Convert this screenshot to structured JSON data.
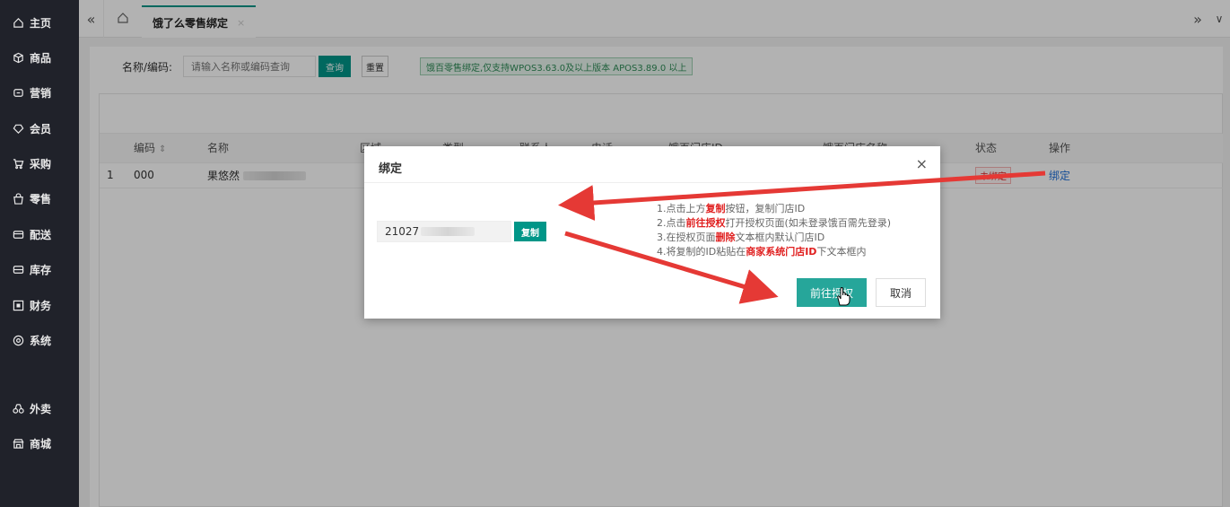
{
  "sidebar": {
    "items": [
      {
        "label": "主页",
        "icon": "home-icon"
      },
      {
        "label": "商品",
        "icon": "box-icon"
      },
      {
        "label": "营销",
        "icon": "tag-icon"
      },
      {
        "label": "会员",
        "icon": "member-icon"
      },
      {
        "label": "采购",
        "icon": "cart-icon"
      },
      {
        "label": "零售",
        "icon": "bag-icon"
      },
      {
        "label": "配送",
        "icon": "truck-icon"
      },
      {
        "label": "库存",
        "icon": "stock-icon"
      },
      {
        "label": "财务",
        "icon": "finance-icon"
      },
      {
        "label": "系统",
        "icon": "settings-icon"
      },
      {
        "label": "外卖",
        "icon": "takeout-icon"
      },
      {
        "label": "商城",
        "icon": "store-icon"
      }
    ]
  },
  "tabs": {
    "prev": "«",
    "next": "»",
    "dropdown": "∨",
    "active_label": "饿了么零售绑定",
    "close": "×"
  },
  "filter": {
    "label": "名称/编码:",
    "placeholder": "请输入名称或编码查询",
    "query_label": "查询",
    "reset_label": "重置",
    "notice": "饿百零售绑定,仅支持WPOS3.63.0及以上版本 APOS3.89.0 以上"
  },
  "table": {
    "headers": [
      "编码",
      "名称",
      "区域",
      "类型",
      "联系人",
      "电话",
      "饿百门店ID",
      "饿百门店名称",
      "状态",
      "操作"
    ],
    "rows": [
      {
        "index": "1",
        "code": "000",
        "name": "果悠然",
        "status": "未绑定",
        "action": "绑定"
      }
    ]
  },
  "modal": {
    "title": "绑定",
    "close": "×",
    "store_id_prefix": "21027",
    "copy_label": "复制",
    "steps": [
      {
        "parts": [
          "1.点击上方",
          "复制",
          "按钮，复制门店ID"
        ]
      },
      {
        "parts": [
          "2.点击",
          "前往授权",
          "打开授权页面(如未登录饿百需先登录)"
        ]
      },
      {
        "parts": [
          "3.在授权页面",
          "删除",
          "文本框内默认门店ID"
        ]
      },
      {
        "parts": [
          "4.将复制的ID粘贴在",
          "商家系统门店ID",
          "下文本框内"
        ]
      }
    ],
    "go_label": "前往授权",
    "cancel_label": "取消"
  },
  "colors": {
    "accent": "#009688",
    "sidebar_bg": "#20222a",
    "highlight_red": "#e02020",
    "annotation_arrow": "#e53935"
  }
}
